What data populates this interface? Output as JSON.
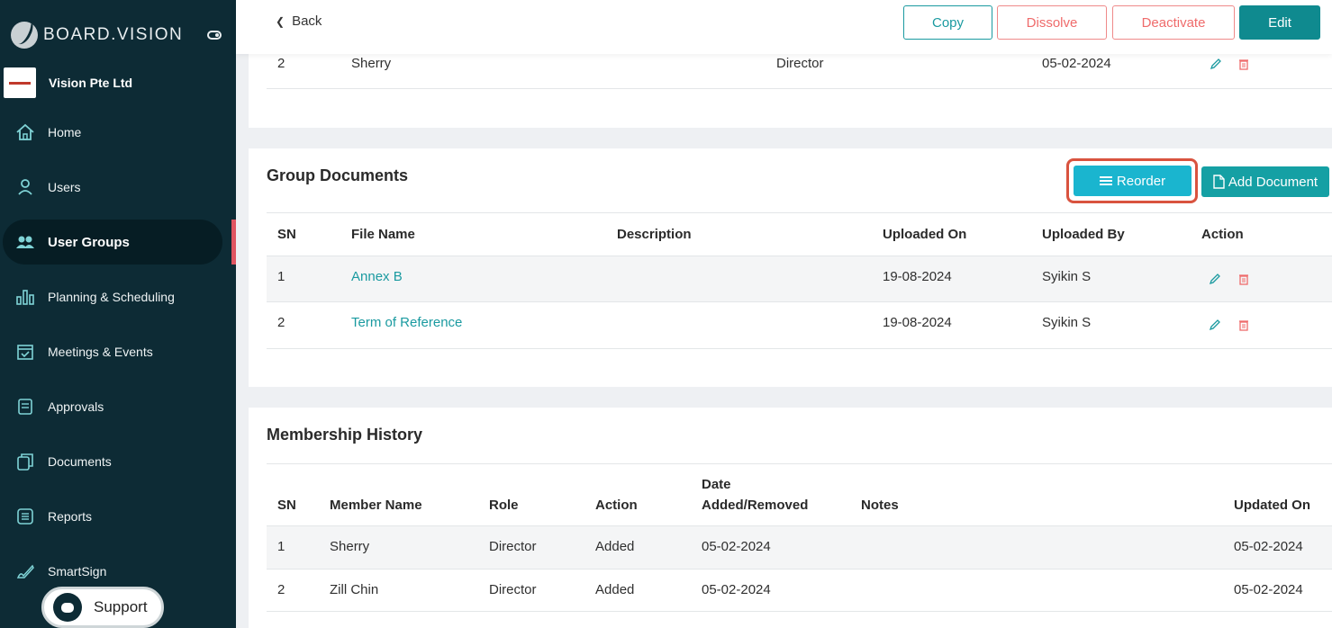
{
  "app": {
    "brand": "BOARD.VISION",
    "org_name": "Vision Pte Ltd"
  },
  "sidebar": {
    "items": [
      {
        "label": "Home",
        "icon": "home-icon"
      },
      {
        "label": "Users",
        "icon": "user-icon"
      },
      {
        "label": "User Groups",
        "icon": "user-group-icon",
        "active": true
      },
      {
        "label": "Planning & Scheduling",
        "icon": "chart-bars-icon"
      },
      {
        "label": "Meetings & Events",
        "icon": "calendar-icon"
      },
      {
        "label": "Approvals",
        "icon": "approval-doc-icon"
      },
      {
        "label": "Documents",
        "icon": "documents-icon"
      },
      {
        "label": "Reports",
        "icon": "report-icon"
      },
      {
        "label": "SmartSign",
        "icon": "pen-sign-icon"
      }
    ],
    "support_label": "Support"
  },
  "toolbar": {
    "back_label": "Back",
    "copy_label": "Copy",
    "dissolve_label": "Dissolve",
    "deactivate_label": "Deactivate",
    "edit_label": "Edit"
  },
  "members": {
    "rows": [
      {
        "sn": "2",
        "name": "Sherry",
        "role": "Director",
        "date": "05-02-2024"
      }
    ]
  },
  "group_documents": {
    "title": "Group Documents",
    "reorder_label": "Reorder",
    "add_label": "Add Document",
    "columns": [
      "SN",
      "File Name",
      "Description",
      "Uploaded On",
      "Uploaded By",
      "Action"
    ],
    "rows": [
      {
        "sn": "1",
        "file_name": "Annex B",
        "description": "",
        "uploaded_on": "19-08-2024",
        "uploaded_by": "Syikin S"
      },
      {
        "sn": "2",
        "file_name": "Term of Reference",
        "description": "",
        "uploaded_on": "19-08-2024",
        "uploaded_by": "Syikin S"
      }
    ]
  },
  "membership_history": {
    "title": "Membership History",
    "columns": [
      "SN",
      "Member Name",
      "Role",
      "Action",
      "Date",
      "Added/Removed",
      "Notes",
      "Updated On"
    ],
    "rows": [
      {
        "sn": "1",
        "member": "Sherry",
        "role": "Director",
        "action": "Added",
        "date": "05-02-2024",
        "notes": "",
        "updated_on": "05-02-2024"
      },
      {
        "sn": "2",
        "member": "Zill Chin",
        "role": "Director",
        "action": "Added",
        "date": "05-02-2024",
        "notes": "",
        "updated_on": "05-02-2024"
      }
    ]
  },
  "colors": {
    "sidebar_bg": "#0d2b35",
    "accent_teal": "#1a9aa0",
    "danger": "#ef6b6b",
    "reorder": "#1ab5cf"
  }
}
